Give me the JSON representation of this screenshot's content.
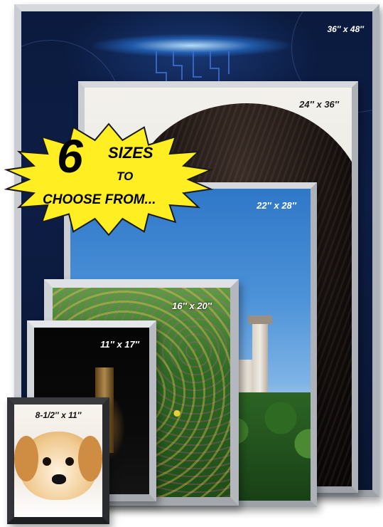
{
  "badge": {
    "number": "6",
    "line1": "SIZES",
    "line2": "TO",
    "line3": "CHOOSE FROM..."
  },
  "frames": [
    {
      "id": "36x48",
      "label": "36″ x 48″"
    },
    {
      "id": "24x36",
      "label": "24″ x 36″"
    },
    {
      "id": "22x28",
      "label": "22″ x 28″"
    },
    {
      "id": "16x20",
      "label": "16″ x 20″"
    },
    {
      "id": "11x17",
      "label": "11″ x 17″"
    },
    {
      "id": "8.5x11",
      "label": "8-1/2″ x 11″"
    }
  ],
  "colors": {
    "badge_fill": "#ffee22",
    "frame_silver": "#c9ccd1",
    "frame_black": "#2a2b2e"
  }
}
